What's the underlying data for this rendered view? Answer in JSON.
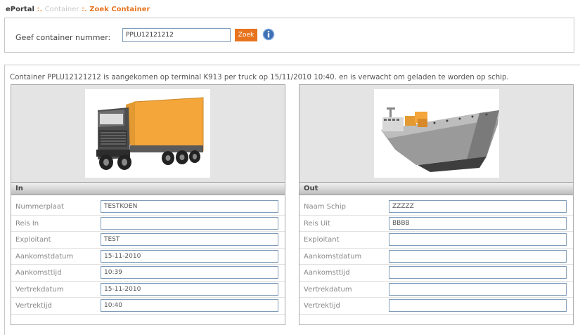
{
  "breadcrumb": {
    "root": "ePortal",
    "separator": " :. ",
    "middle": "Container",
    "current": "Zoek Container"
  },
  "search": {
    "label": "Geef container nummer:",
    "value": "PPLU12121212",
    "button": "Zoek",
    "info_icon": "info-icon"
  },
  "result": {
    "message": "Container PPLU12121212 is aangekomen op terminal K913 per truck op 15/11/2010 10:40. en is verwacht om geladen te worden op schip."
  },
  "panel_in": {
    "title": "In",
    "image": "truck-image",
    "fields": [
      {
        "label": "Nummerplaat",
        "value": "TESTKOEN"
      },
      {
        "label": "Reis In",
        "value": ""
      },
      {
        "label": "Exploitant",
        "value": "TEST"
      },
      {
        "label": "Aankomstdatum",
        "value": "15-11-2010"
      },
      {
        "label": "Aankomsttijd",
        "value": "10:39"
      },
      {
        "label": "Vertrekdatum",
        "value": "15-11-2010"
      },
      {
        "label": "Vertrektijd",
        "value": "10:40"
      }
    ]
  },
  "panel_out": {
    "title": "Out",
    "image": "ship-image",
    "fields": [
      {
        "label": "Naam Schip",
        "value": "ZZZZZ"
      },
      {
        "label": "Reis Uit",
        "value": "BBBB"
      },
      {
        "label": "Exploitant",
        "value": ""
      },
      {
        "label": "Aankomstdatum",
        "value": ""
      },
      {
        "label": "Aankomsttijd",
        "value": ""
      },
      {
        "label": "Vertrekdatum",
        "value": ""
      },
      {
        "label": "Vertrektijd",
        "value": ""
      }
    ]
  },
  "colors": {
    "accent": "#e8731e",
    "border": "#c8c8c8",
    "input_border": "#7f9db9"
  }
}
